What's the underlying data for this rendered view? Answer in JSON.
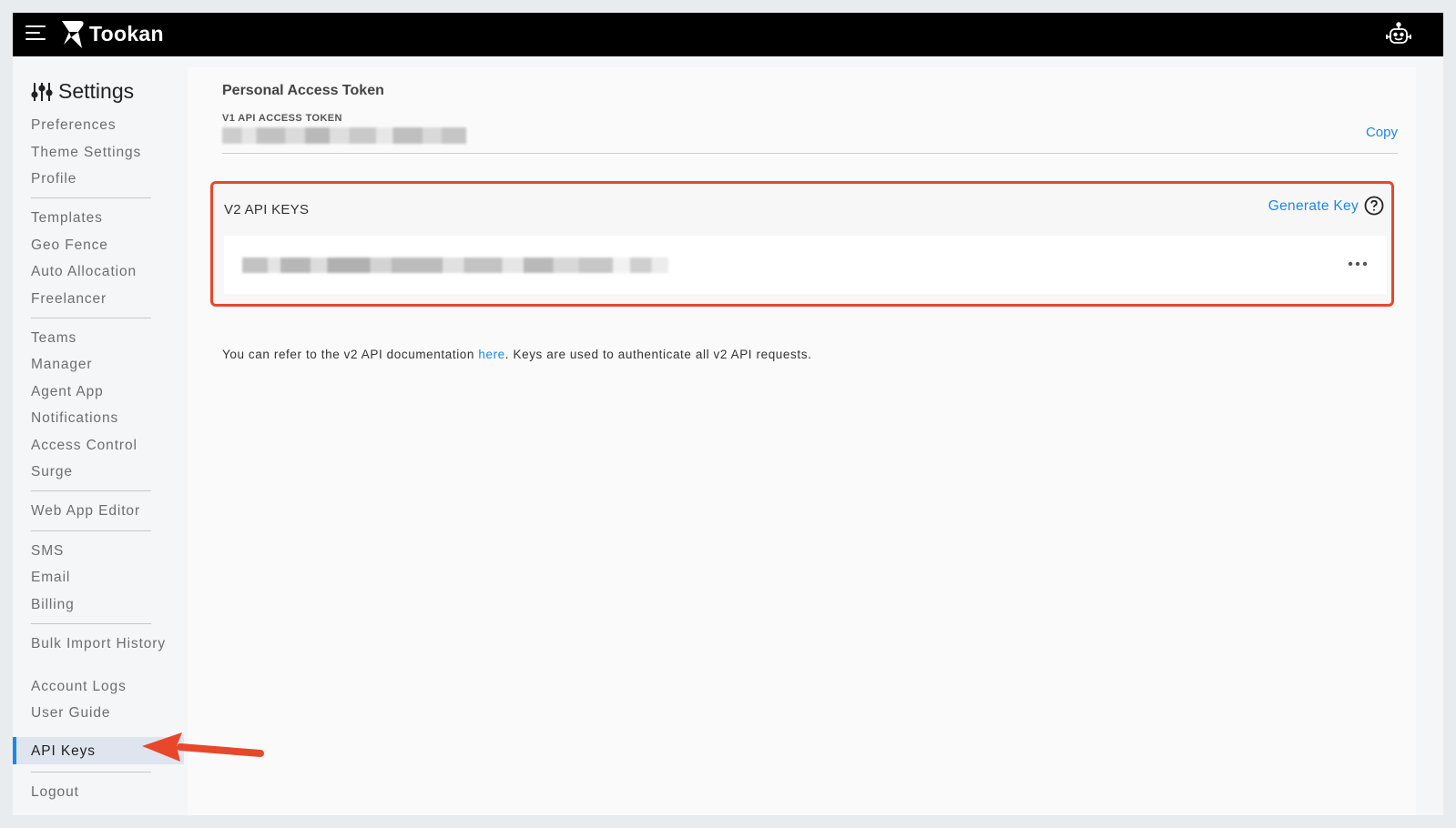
{
  "app": {
    "brand": "Tookan"
  },
  "sidebar": {
    "title": "Settings",
    "groups": [
      [
        "Preferences",
        "Theme Settings",
        "Profile"
      ],
      [
        "Templates",
        "Geo Fence",
        "Auto Allocation",
        "Freelancer"
      ],
      [
        "Teams",
        "Manager",
        "Agent App",
        "Notifications",
        "Access Control",
        "Surge"
      ],
      [
        "Web App Editor"
      ],
      [
        "SMS",
        "Email",
        "Billing"
      ],
      [
        "Bulk Import History",
        "Account Logs",
        "User Guide",
        "API Keys"
      ],
      [
        "Logout"
      ]
    ],
    "items": {
      "preferences": "Preferences",
      "theme_settings": "Theme Settings",
      "profile": "Profile",
      "templates": "Templates",
      "geo_fence": "Geo Fence",
      "auto_allocation": "Auto Allocation",
      "freelancer": "Freelancer",
      "teams": "Teams",
      "manager": "Manager",
      "agent_app": "Agent App",
      "notifications": "Notifications",
      "access_control": "Access Control",
      "surge": "Surge",
      "web_app_editor": "Web App Editor",
      "sms": "SMS",
      "email": "Email",
      "billing": "Billing",
      "bulk_import_history": "Bulk Import History",
      "account_logs": "Account Logs",
      "user_guide": "User Guide",
      "api_keys": "API Keys",
      "logout": "Logout"
    },
    "active": "API Keys"
  },
  "main": {
    "pat_title": "Personal Access Token",
    "v1_label": "V1 API ACCESS TOKEN",
    "copy_label": "Copy",
    "v2_title": "V2 API KEYS",
    "generate_key_label": "Generate Key",
    "doc_text_before": "You can refer to the v2 API documentation ",
    "doc_link": "here",
    "doc_text_after": ". Keys are used to authenticate all v2 API requests."
  },
  "colors": {
    "accent": "#1e88e5",
    "highlight": "#e8472b",
    "topbar": "#000000"
  },
  "icons": {
    "menu": "hamburger-icon",
    "logo": "tookan-logo-icon",
    "bot": "robot-icon",
    "settings": "sliders-icon",
    "help": "question-circle-icon",
    "more": "ellipsis-icon",
    "annotation": "red-arrow-icon"
  }
}
